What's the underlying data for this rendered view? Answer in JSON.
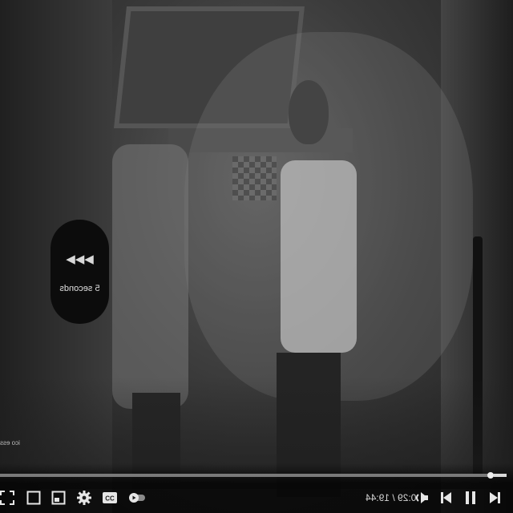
{
  "player": {
    "seek_feedback": {
      "arrows": "◀◀◀",
      "label": "5 seconds"
    },
    "side_caption": "ico ess",
    "time_display": "0:29 / 19:44",
    "progress_fraction": 0.025,
    "icons": {
      "fullscreen": "fullscreen-icon",
      "theater": "theater-mode-icon",
      "miniplayer": "miniplayer-icon",
      "settings": "gear-icon",
      "captions": "captions-icon",
      "autoplay": "autoplay-toggle-icon",
      "volume": "volume-icon",
      "previous": "previous-icon",
      "pause": "pause-icon",
      "next": "next-icon"
    },
    "colors": {
      "accent": "#d9d9d9",
      "bubble": "#0c0c0c"
    }
  }
}
